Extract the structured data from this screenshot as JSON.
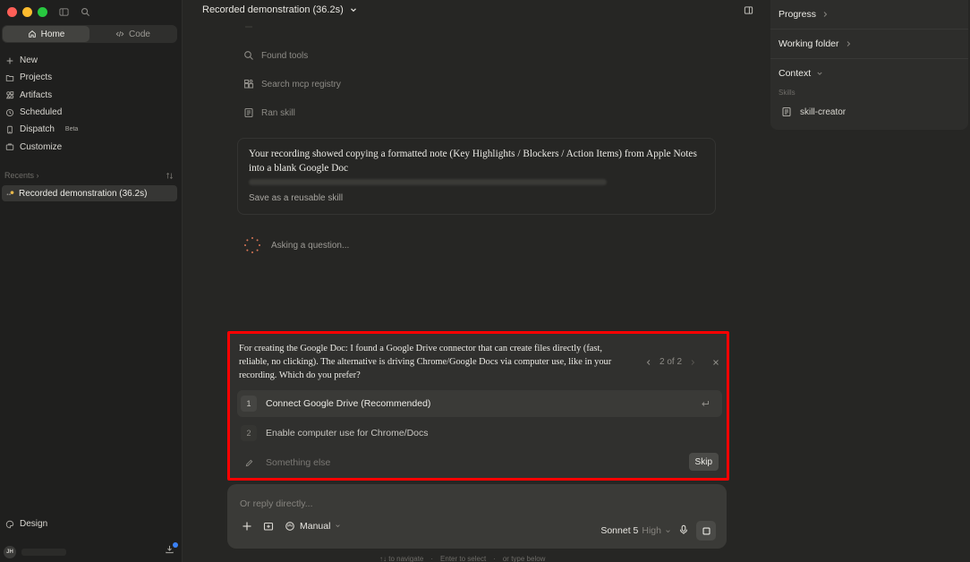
{
  "sidebar": {
    "tabs": [
      {
        "label": "Home",
        "icon": "home-icon",
        "active": true
      },
      {
        "label": "Code",
        "icon": "code-icon",
        "active": false
      }
    ],
    "nav": [
      {
        "label": "New",
        "icon": "plus-icon"
      },
      {
        "label": "Projects",
        "icon": "folder-icon"
      },
      {
        "label": "Artifacts",
        "icon": "artifacts-icon"
      },
      {
        "label": "Scheduled",
        "icon": "clock-icon"
      },
      {
        "label": "Dispatch",
        "icon": "phone-icon",
        "badge": "Beta"
      },
      {
        "label": "Customize",
        "icon": "briefcase-icon"
      }
    ],
    "recents_label": "Recents",
    "recent_items": [
      {
        "label": "Recorded demonstration (36.2s)"
      }
    ],
    "design_label": "Design",
    "user_initials": "JH"
  },
  "main": {
    "title": "Recorded demonstration (36.2s)",
    "steps": [
      {
        "label": "Found tools",
        "icon": "search-icon"
      },
      {
        "label": "Search mcp registry",
        "icon": "registry-icon"
      },
      {
        "label": "Ran skill",
        "icon": "skill-icon"
      }
    ],
    "summary": {
      "text": "Your recording showed copying a formatted note (Key Highlights / Blockers / Action Items) from Apple Notes into a blank Google Doc",
      "link": "Save as a reusable skill"
    },
    "status": "Asking a question..."
  },
  "question": {
    "text": "For creating the Google Doc: I found a Google Drive connector that can create files directly (fast, reliable, no clicking). The alternative is driving Chrome/Google Docs via computer use, like in your recording. Which do you prefer?",
    "pager": "2 of 2",
    "options": [
      {
        "num": "1",
        "label": "Connect Google Drive (Recommended)"
      },
      {
        "num": "2",
        "label": "Enable computer use for Chrome/Docs"
      }
    ],
    "other_placeholder": "Something else",
    "skip_label": "Skip"
  },
  "composer": {
    "placeholder": "Or reply directly...",
    "mode": "Manual",
    "model": "Sonnet 5",
    "effort": "High"
  },
  "hints": [
    "↑↓ to navigate",
    "·",
    "Enter to select",
    "·",
    "or type below"
  ],
  "right_panel": {
    "progress": "Progress",
    "working_folder": "Working folder",
    "context": "Context",
    "skills_label": "Skills",
    "skill": "skill-creator"
  }
}
